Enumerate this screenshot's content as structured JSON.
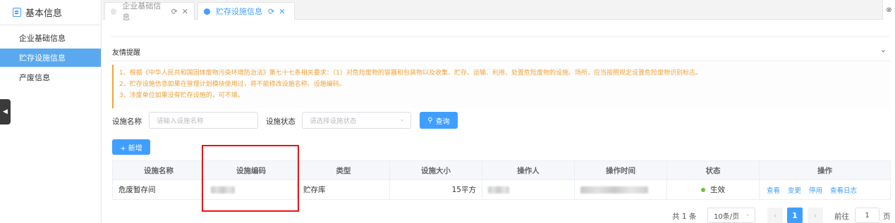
{
  "sidebar": {
    "title": "基本信息",
    "items": [
      {
        "label": "企业基础信息",
        "active": false
      },
      {
        "label": "贮存设施信息",
        "active": true
      },
      {
        "label": "产废信息",
        "active": false
      }
    ]
  },
  "tabs": [
    {
      "label": "企业基础信息",
      "active": false
    },
    {
      "label": "贮存设施信息",
      "active": true
    }
  ],
  "notice": {
    "title": "友情提醒",
    "lines": [
      "1、根据《中华人民共和国固体废物污染环境防治法》第七十七条相关要求：（1）对危险废物的容器和包装物以及收集、贮存、运输、利用、处置危险废物的设施、场所，应当按照规定设置危险废物识别标志。",
      "2、贮存设施信息如果在管理计划模块使用过，将不能修改设施名称、设施编码。",
      "3、涉废单位如果没有贮存设施的，可不填。"
    ]
  },
  "search": {
    "name_label": "设施名称",
    "name_placeholder": "请输入设施名称",
    "status_label": "设施状态",
    "status_placeholder": "请选择设施状态",
    "query_button": "查询",
    "add_button": "+ 新增"
  },
  "table": {
    "headers": [
      "设施名称",
      "设施编码",
      "类型",
      "设施大小",
      "操作人",
      "操作时间",
      "状态",
      "操作"
    ],
    "rows": [
      {
        "name": "危废暂存间",
        "type": "贮存库",
        "size": "15平方",
        "status": "生效",
        "actions": [
          "查看",
          "变更",
          "停用",
          "查看日志"
        ]
      }
    ]
  },
  "pagination": {
    "total_text": "共 1 条",
    "page_size": "10条/页",
    "current_page": "1",
    "goto_label": "前往",
    "goto_value": "1",
    "page_suffix": "页"
  },
  "colors": {
    "accent": "#409eff",
    "sidebar_active": "#5aa9ee",
    "notice": "#f0a33a",
    "status_active": "#67c23a",
    "highlight_box": "#ee1111"
  }
}
